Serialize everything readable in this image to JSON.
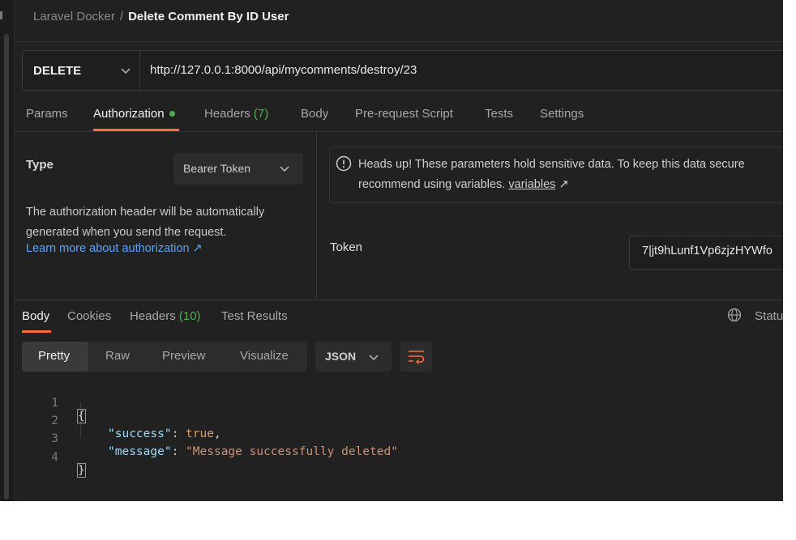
{
  "breadcrumb": {
    "collection": "Laravel Docker",
    "separator": "/",
    "request": "Delete Comment By ID User"
  },
  "request": {
    "method": "DELETE",
    "url": "http://127.0.0.1:8000/api/mycomments/destroy/23"
  },
  "request_tabs": {
    "params": "Params",
    "authorization": "Authorization",
    "headers": "Headers",
    "headers_count": "(7)",
    "body": "Body",
    "prerequest": "Pre-request Script",
    "tests": "Tests",
    "settings": "Settings",
    "active": "Authorization"
  },
  "auth": {
    "type_label": "Type",
    "type_value": "Bearer Token",
    "description": "The authorization header will be automatically generated when you send the request.",
    "learn_more": "Learn more about authorization ↗",
    "headsup_line1": "Heads up! These parameters hold sensitive data. To keep this data secure",
    "headsup_line2_prefix": "recommend using variables.",
    "headsup_link": "variables",
    "headsup_arrow": "↗",
    "token_label": "Token",
    "token_value": "7|jt9hLunf1Vp6zjzHYWfo"
  },
  "response_tabs": {
    "body": "Body",
    "cookies": "Cookies",
    "headers": "Headers",
    "headers_count": "(10)",
    "test_results": "Test Results",
    "status": "Statu",
    "active": "Body"
  },
  "view_modes": {
    "pretty": "Pretty",
    "raw": "Raw",
    "preview": "Preview",
    "visualize": "Visualize",
    "active": "Pretty"
  },
  "format": "JSON",
  "response_body": {
    "line_numbers": [
      "1",
      "2",
      "3",
      "4"
    ],
    "open_brace": "{",
    "close_brace": "}",
    "key1": "\"success\"",
    "colon": ": ",
    "val1": "true",
    "comma": ",",
    "key2": "\"message\"",
    "val2": "\"Message successfully deleted\""
  },
  "colors": {
    "accent": "#ff6c37",
    "success": "#4caf50",
    "link": "#5ba3ff",
    "background": "#212121"
  },
  "icons": [
    "chevron-down-icon",
    "info-icon",
    "globe-icon",
    "wrap-lines-icon"
  ]
}
